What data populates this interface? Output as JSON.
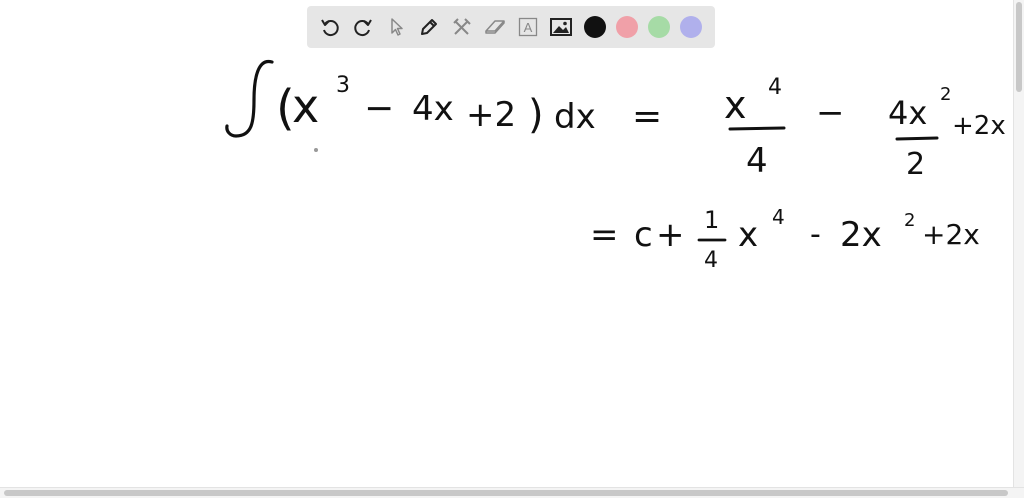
{
  "toolbar": {
    "tools": [
      {
        "name": "undo",
        "icon": "undo-icon"
      },
      {
        "name": "redo",
        "icon": "redo-icon"
      },
      {
        "name": "select",
        "icon": "pointer-icon"
      },
      {
        "name": "pen",
        "icon": "pen-icon"
      },
      {
        "name": "tools",
        "icon": "tools-icon"
      },
      {
        "name": "eraser",
        "icon": "eraser-icon"
      },
      {
        "name": "text",
        "icon": "text-icon",
        "label": "A"
      },
      {
        "name": "image",
        "icon": "image-icon"
      }
    ],
    "colors": [
      "#111111",
      "#f0a0a8",
      "#a6dba6",
      "#b0b0ec"
    ]
  },
  "writing": {
    "line1_integral": "∫",
    "line1_open": "(",
    "line1_x": "x",
    "line1_exp3": "3",
    "line1_minus": "−",
    "line1_4x": "4x",
    "line1_plus2": "+2",
    "line1_close": ")",
    "line1_dx": "dx",
    "line1_equals": "=",
    "frac1_num": "x",
    "frac1_num_exp": "4",
    "frac1_den": "4",
    "line1_minus2": "−",
    "frac2_num": "4x",
    "frac2_num_exp": "2",
    "frac2_den": "2",
    "line1_tail": "+2x",
    "line2_equals": "=",
    "line2_c": "c",
    "line2_plus": "+",
    "frac3_num": "1",
    "frac3_den": "4",
    "line2_x": "x",
    "line2_x_exp": "4",
    "line2_minus": "-",
    "line2_2x": "2x",
    "line2_2x_exp": "2",
    "line2_tail": "+2x"
  }
}
